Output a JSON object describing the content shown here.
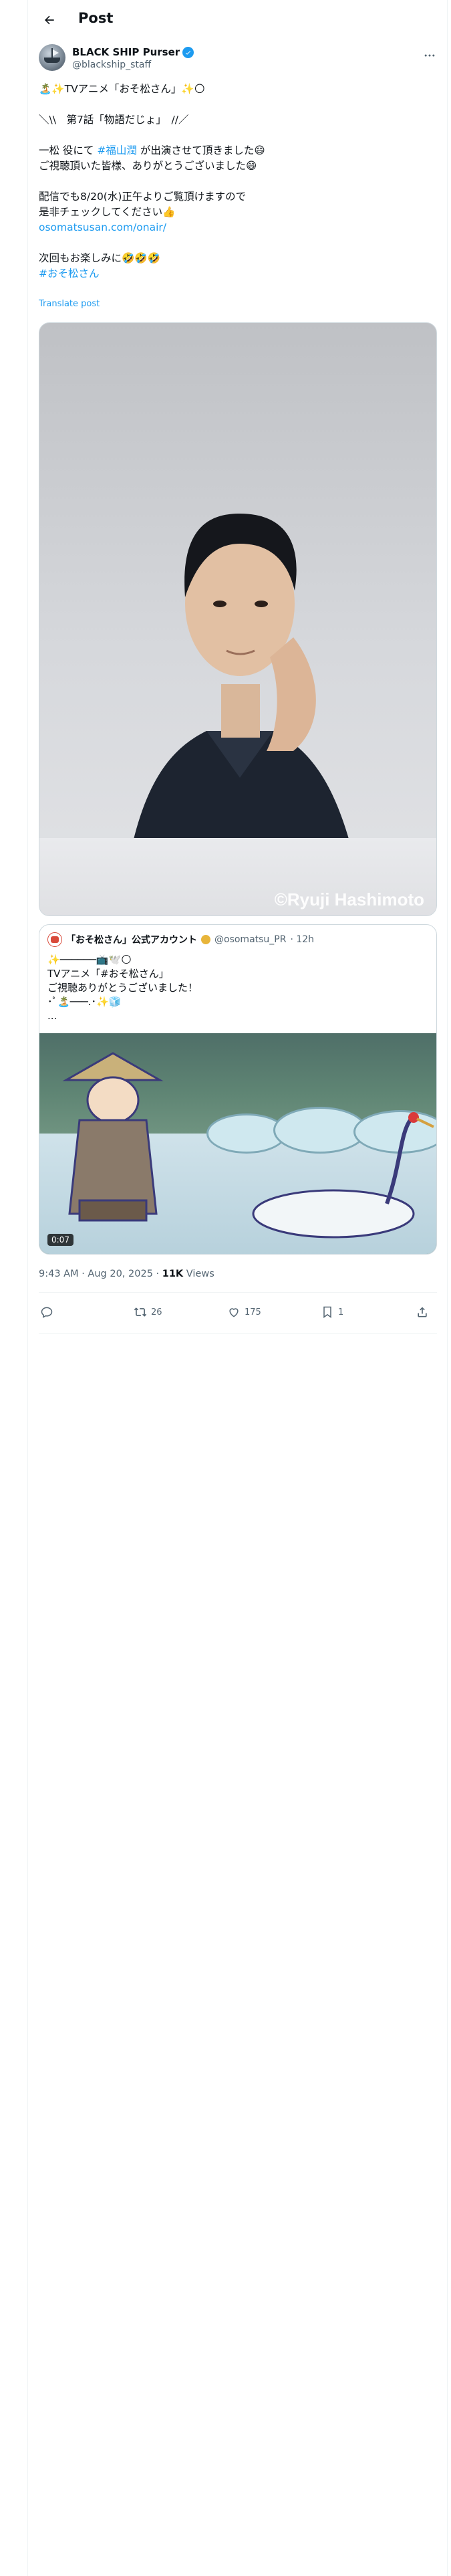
{
  "header": {
    "title": "Post"
  },
  "author": {
    "name": "BLACK SHIP Purser",
    "handle": "@blackship_staff"
  },
  "post": {
    "lines": [
      "🏝️✨TVアニメ「おそ松さん」✨🌕",
      "",
      "＼\\\\　第7話「物語だじょ」　//／",
      "",
      "一松 役にて",
      "#福山潤",
      "が出演させて頂きました😄",
      "ご視聴頂いた皆様、ありがとうございました😄",
      "",
      "配信でも8/20(水)正午よりご覧頂けますので",
      "是非チェックしてください👍",
      "osomatsusan.com/onair/",
      "",
      "次回もお楽しみに🤣🤣🤣",
      "#おそ松さん"
    ],
    "translate_label": "Translate post",
    "photo_watermark": "©Ryuji Hashimoto"
  },
  "quote": {
    "name": "「おそ松さん」公式アカウント",
    "handle": "@osomatsu_PR",
    "time": "· 12h",
    "lines": [
      "✨──────📺🕊️🌕",
      "TVアニメ「#おそ松さん」",
      "ご視聴ありがとうございました！",
      "･ﾟ🏝️───.･✨🧊",
      "..."
    ],
    "video_duration": "0:07"
  },
  "meta": {
    "time": "9:43 AM · Aug 20, 2025 · ",
    "views_count": "11K",
    "views_label": " Views"
  },
  "actions": {
    "reply": "",
    "repost": "26",
    "like": "175",
    "bookmark": "1"
  },
  "colors": {
    "accent": "#1d9bf0",
    "text": "#0f1419",
    "muted": "#536471",
    "border": "#eff3f4"
  }
}
